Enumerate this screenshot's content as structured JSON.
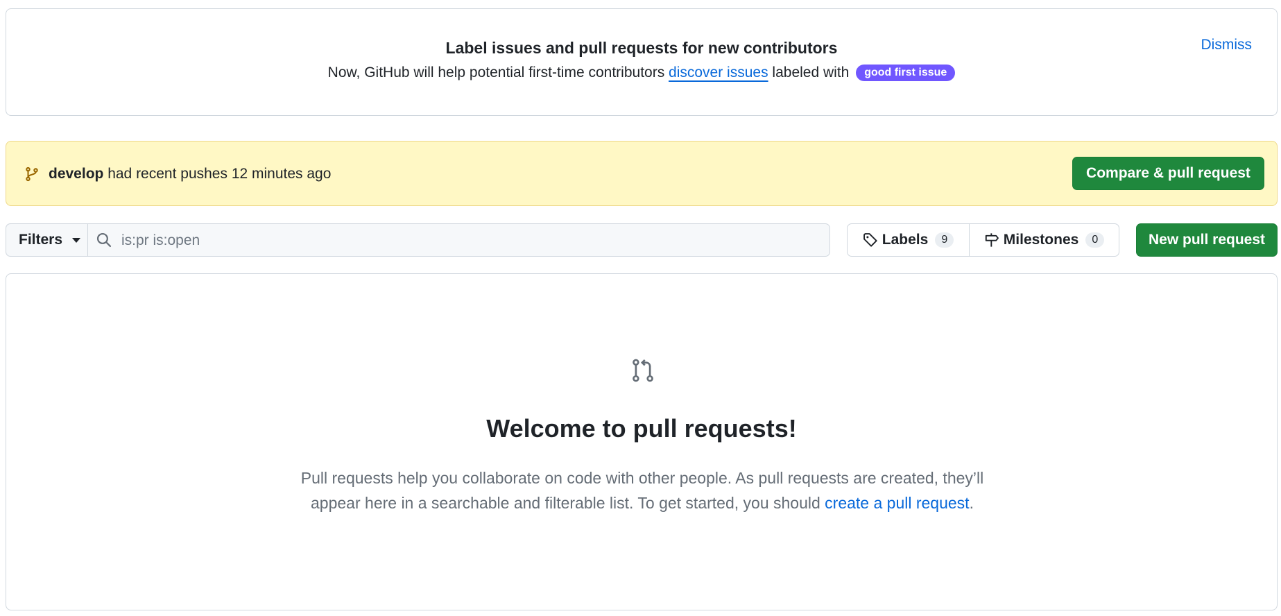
{
  "banner": {
    "title": "Label issues and pull requests for new contributors",
    "text_before": "Now, GitHub will help potential first-time contributors ",
    "link": "discover issues",
    "text_after": " labeled with",
    "label_pill": "good first issue",
    "dismiss": "Dismiss"
  },
  "pushes": {
    "branch": "develop",
    "message": " had recent pushes 12 minutes ago",
    "compare_button": "Compare & pull request"
  },
  "toolbar": {
    "filters": "Filters",
    "search_placeholder": "is:pr is:open",
    "labels": "Labels",
    "labels_count": "9",
    "milestones": "Milestones",
    "milestones_count": "0",
    "new_pr_button": "New pull request"
  },
  "blankslate": {
    "title": "Welcome to pull requests!",
    "text": "Pull requests help you collaborate on code with other people. As pull requests are created, they’ll appear here in a searchable and filterable list. To get started, you should ",
    "link": "create a pull request",
    "text_end": "."
  },
  "colors": {
    "primary_green": "#1f883d",
    "link_blue": "#0969da",
    "pill_purple": "#7057ff",
    "flash_yellow": "#fff8c5"
  }
}
